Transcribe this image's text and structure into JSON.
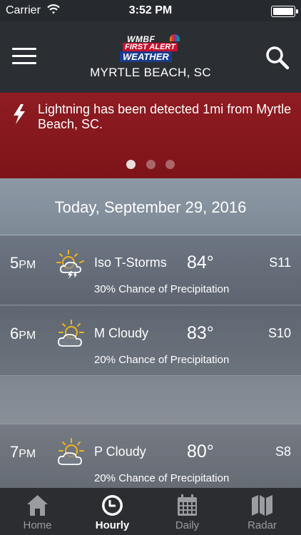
{
  "status_bar": {
    "carrier": "Carrier",
    "time": "3:52 PM"
  },
  "header": {
    "logo": {
      "line1": "WMBF",
      "line2": "FIRST ALERT",
      "line3": "WEATHER"
    },
    "location": "MYRTLE BEACH, SC"
  },
  "alert": {
    "message": "Lightning has been detected 1mi from Myrtle Beach, SC.",
    "pages": 3,
    "active_page": 1
  },
  "forecast": {
    "date": "Today, September 29, 2016",
    "hours": [
      {
        "hour": "5",
        "ampm": "PM",
        "icon": "sun-cloud-thunder-icon",
        "condition": "Iso T-Storms",
        "temp": "84°",
        "wind": "S11",
        "precip": "30% Chance of Precipitation"
      },
      {
        "hour": "6",
        "ampm": "PM",
        "icon": "partly-cloudy-icon",
        "condition": "M Cloudy",
        "temp": "83°",
        "wind": "S10",
        "precip": "20% Chance of Precipitation"
      },
      {
        "hour": "7",
        "ampm": "PM",
        "icon": "partly-cloudy-icon",
        "condition": "P Cloudy",
        "temp": "80°",
        "wind": "S8",
        "precip": "20% Chance of Precipitation"
      }
    ]
  },
  "tabs": [
    {
      "label": "Home",
      "icon": "home-icon",
      "active": false
    },
    {
      "label": "Hourly",
      "icon": "clock-icon",
      "active": true
    },
    {
      "label": "Daily",
      "icon": "calendar-icon",
      "active": false
    },
    {
      "label": "Radar",
      "icon": "map-icon",
      "active": false
    }
  ],
  "colors": {
    "alert_red": "#8f1c22",
    "bar_dark": "#2b2e33",
    "sun_yellow": "#f2b41e"
  }
}
